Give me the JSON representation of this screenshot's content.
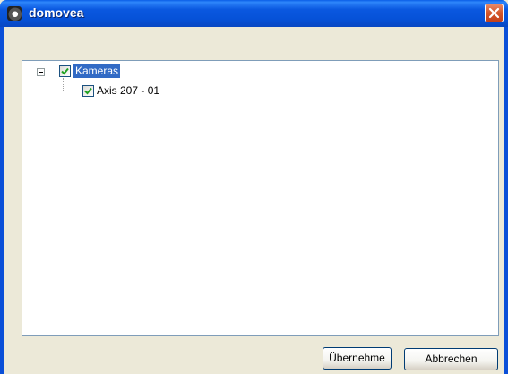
{
  "window": {
    "title": "domovea"
  },
  "tree": {
    "root": {
      "label": "Kameras",
      "checked": true,
      "expanded": true
    },
    "children": [
      {
        "label": "Axis 207 - 01",
        "checked": true
      }
    ]
  },
  "buttons": {
    "ok_label": "Übernehme",
    "cancel_label": "Abbrechen"
  },
  "colors": {
    "titlebar": "#0a58e0",
    "selection": "#316ac5",
    "check": "#21a121",
    "dialog_bg": "#ece9d8"
  }
}
